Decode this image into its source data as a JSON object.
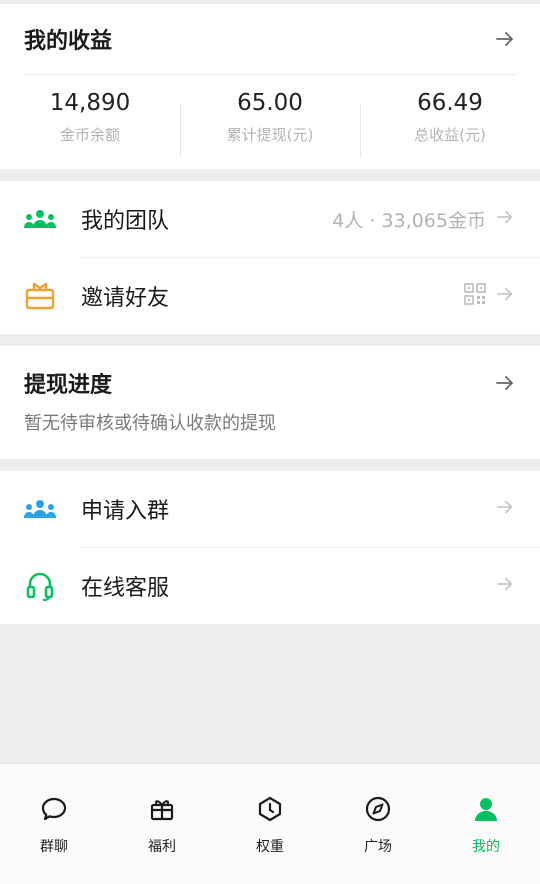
{
  "earnings": {
    "title": "我的收益",
    "stats": [
      {
        "value": "14,890",
        "label": "金币余额"
      },
      {
        "value": "65.00",
        "label": "累计提现(元)"
      },
      {
        "value": "66.49",
        "label": "总收益(元)"
      }
    ]
  },
  "team": {
    "label": "我的团队",
    "meta": "4人 · 33,065金币",
    "icon": "team-icon",
    "color": "#07c160"
  },
  "invite": {
    "label": "邀请好友",
    "icon": "gift-box-icon",
    "color": "#f0a030"
  },
  "withdraw": {
    "title": "提现进度",
    "subtitle": "暂无待审核或待确认收款的提现"
  },
  "join_group": {
    "label": "申请入群",
    "icon": "group-icon",
    "color": "#2aa3e8"
  },
  "support": {
    "label": "在线客服",
    "icon": "headset-icon",
    "color": "#07c160"
  },
  "tabbar": [
    {
      "label": "群聊",
      "icon": "chat-bubble-icon"
    },
    {
      "label": "福利",
      "icon": "gift-icon"
    },
    {
      "label": "权重",
      "icon": "weight-icon"
    },
    {
      "label": "广场",
      "icon": "compass-icon"
    },
    {
      "label": "我的",
      "icon": "user-icon",
      "active": true
    }
  ],
  "colors": {
    "accent": "#07c160",
    "muted": "#b3b3b3",
    "background": "#ededed"
  }
}
